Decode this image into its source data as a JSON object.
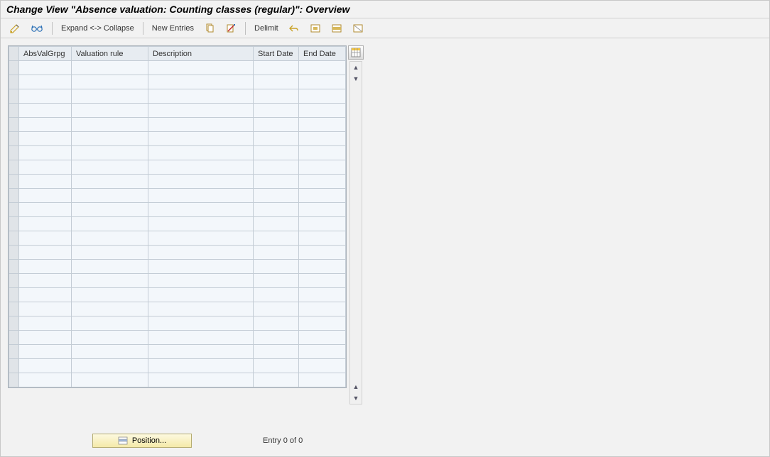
{
  "title": "Change View \"Absence valuation: Counting classes (regular)\": Overview",
  "toolbar": {
    "expand_collapse": "Expand <-> Collapse",
    "new_entries": "New Entries",
    "delimit": "Delimit"
  },
  "table": {
    "columns": {
      "absvalgrpg": "AbsValGrpg",
      "valuation_rule": "Valuation rule",
      "description": "Description",
      "start_date": "Start Date",
      "end_date": "End Date"
    },
    "row_count": 23
  },
  "footer": {
    "position_label": "Position...",
    "entry_text": "Entry 0 of 0"
  }
}
